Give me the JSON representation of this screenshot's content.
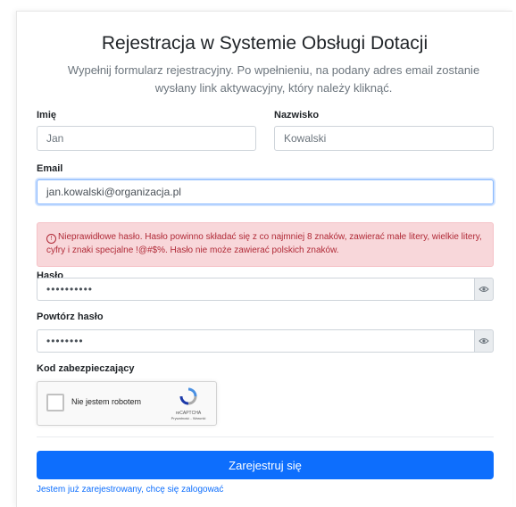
{
  "form": {
    "title": "Rejestracja w Systemie Obsługi Dotacji",
    "subtitle": "Wypełnij formularz rejestracyjny. Po wpełnieniu, na podany adres email zostanie wysłany link aktywacyjny, który należy kliknąć.",
    "first_name": {
      "label": "Imię",
      "placeholder": "Jan"
    },
    "last_name": {
      "label": "Nazwisko",
      "placeholder": "Kowalski"
    },
    "email": {
      "label": "Email",
      "value": "jan.kowalski@organizacja.pl"
    },
    "alert": {
      "icon": "exclamation-circle-icon",
      "text": "Nieprawidłowe hasło. Hasło powinno składać się z co najmniej 8 znaków, zawierać małe litery, wielkie litery, cyfry i znaki specjalne !@#$%. Hasło nie może zawierać polskich znaków.",
      "color": "#f8d7da"
    },
    "password": {
      "label": "Hasło",
      "masked_value": "••••••••••",
      "toggle_icon": "eye-icon"
    },
    "confirm_password": {
      "label": "Powtórz hasło",
      "masked_value": "••••••••",
      "toggle_icon": "eye-icon"
    },
    "captcha": {
      "label": "Kod zabezpieczający",
      "checkbox_label": "Nie jestem robotem",
      "brand": "reCAPTCHA",
      "terms": "Prywatność - Warunki"
    },
    "submit_label": "Zarejestruj się",
    "login_link": "Jestem już zarejestrowany, chcę się zalogować",
    "accent_color": "#0d6efd"
  }
}
